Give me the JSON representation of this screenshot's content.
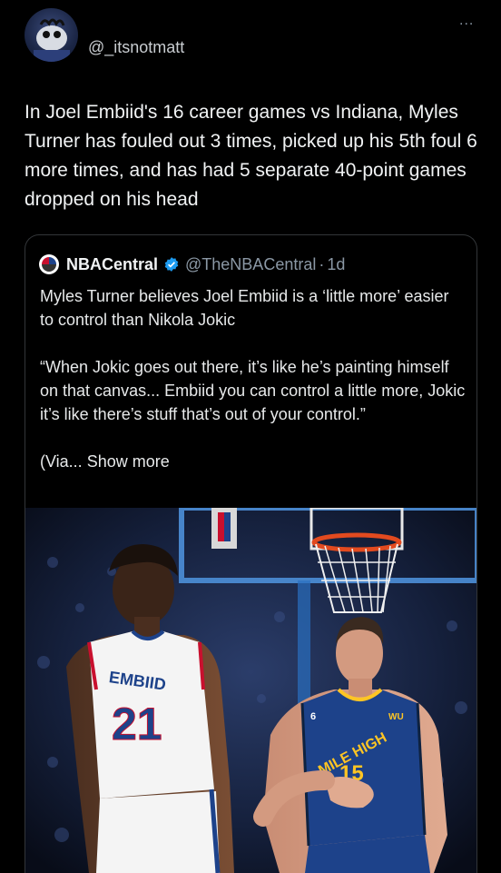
{
  "header": {
    "handle": "@_itsnotmatt",
    "more": "..."
  },
  "tweet": {
    "text": "In Joel Embiid's 16 career games vs Indiana, Myles Turner has fouled out 3 times, picked up his 5th foul 6 more times, and has had 5 separate 40-point games dropped on his head"
  },
  "quote": {
    "name": "NBACentral",
    "username": "@TheNBACentral",
    "separator": "·",
    "time": "1d",
    "paragraph1": "Myles Turner believes Joel Embiid is a ‘little more’ easier to control than Nikola Jokic",
    "paragraph2": "“When Jokic goes out there, it’s like he’s painting himself on that canvas... Embiid you can control a little more, Jokic it’s like there’s stuff that’s out of your control.”",
    "paragraph3_prefix": "(Via...",
    "show_more": "Show more",
    "verified_color": "#1d9bf0"
  },
  "photo": {
    "left_jersey_name": "EMBIID",
    "left_jersey_number": "21",
    "right_jersey_text": "MILE HIGH",
    "right_jersey_number": "15",
    "right_jersey_small_number": "6",
    "right_jersey_sponsor": "WU"
  }
}
